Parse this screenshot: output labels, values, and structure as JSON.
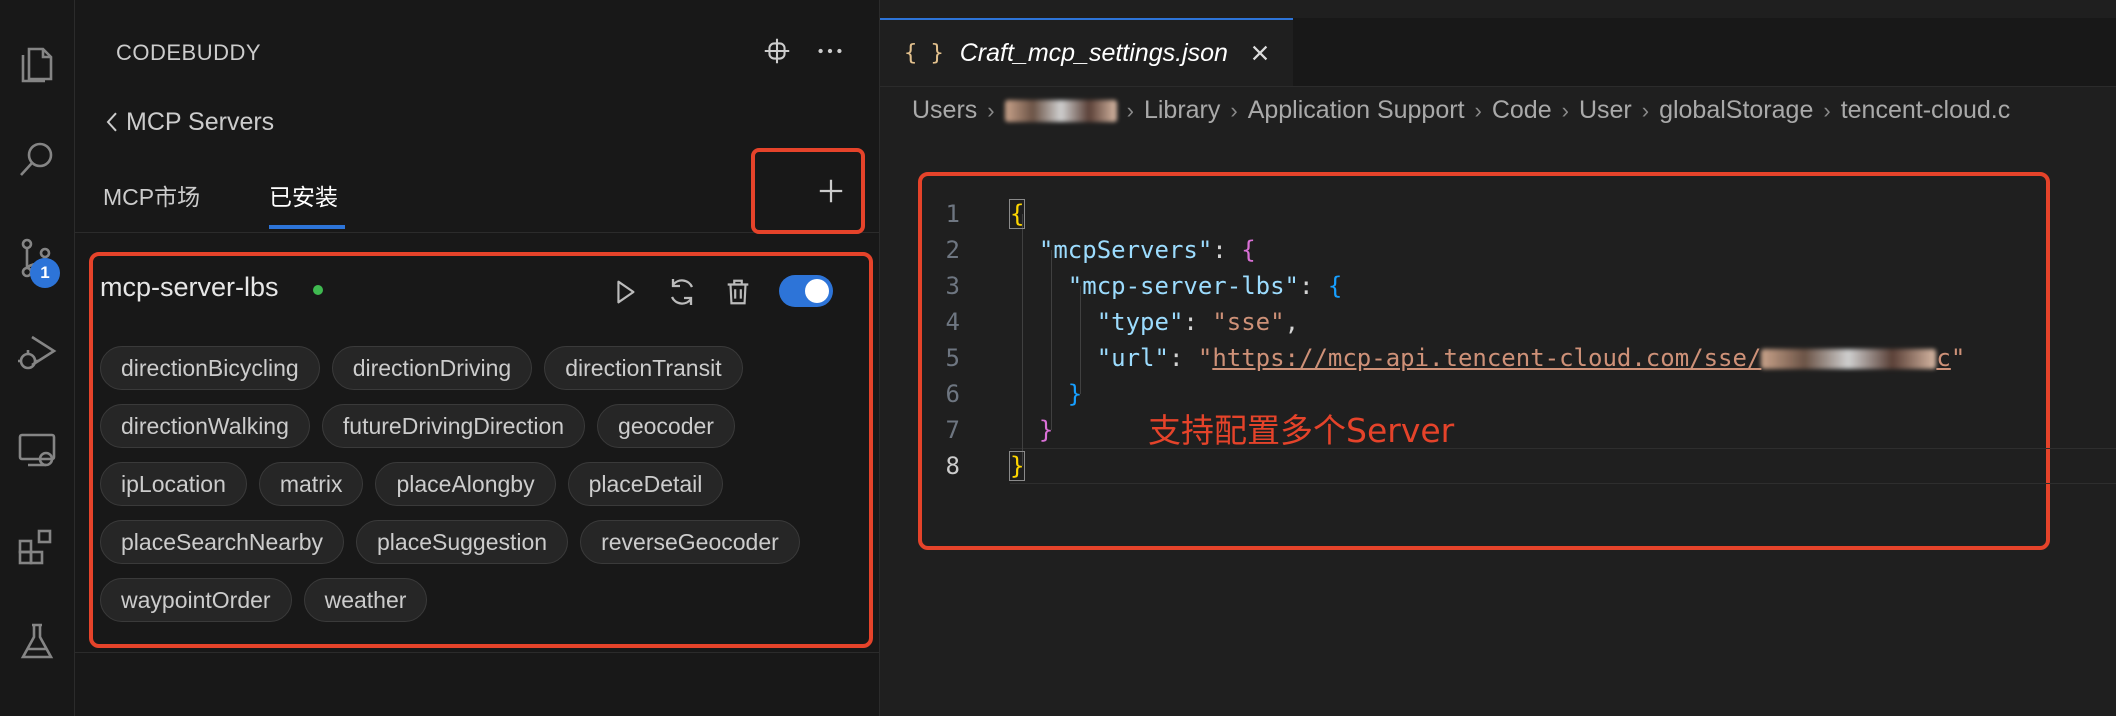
{
  "activity_bar": {
    "icons": [
      "explorer-icon",
      "search-icon",
      "source-control-icon",
      "run-debug-icon",
      "remote-explorer-icon",
      "extensions-icon",
      "testing-icon"
    ],
    "source_control_badge": "1"
  },
  "sidebar": {
    "title": "CODEBUDDY",
    "back_label": "MCP Servers",
    "tabs": [
      {
        "label": "MCP市场",
        "active": false
      },
      {
        "label": "已安装",
        "active": true
      }
    ],
    "add_label": "+",
    "server": {
      "name": "mcp-server-lbs",
      "status": "running",
      "enabled": true,
      "tools": [
        "directionBicycling",
        "directionDriving",
        "directionTransit",
        "directionWalking",
        "futureDrivingDirection",
        "geocoder",
        "ipLocation",
        "matrix",
        "placeAlongby",
        "placeDetail",
        "placeSearchNearby",
        "placeSuggestion",
        "reverseGeocoder",
        "waypointOrder",
        "weather"
      ]
    }
  },
  "editor": {
    "tab": {
      "icon_text": "{ }",
      "filename": "Craft_mcp_settings.json"
    },
    "breadcrumb": [
      "Users",
      "Library",
      "Application Support",
      "Code",
      "User",
      "globalStorage",
      "tencent-cloud.c"
    ],
    "code": {
      "line_numbers": [
        "1",
        "2",
        "3",
        "4",
        "5",
        "6",
        "7",
        "8"
      ],
      "key_mcpServers": "\"mcpServers\"",
      "key_server": "\"mcp-server-lbs\"",
      "key_type": "\"type\"",
      "val_type": "\"sse\"",
      "key_url": "\"url\"",
      "val_url_visible": "https://mcp-api.tencent-cloud.com/sse/",
      "val_url_tail": "c"
    },
    "annotation": "支持配置多个Server"
  },
  "colors": {
    "accent": "#2d74d8",
    "highlight_box": "#e5432a",
    "status_ok": "#3fb950"
  }
}
